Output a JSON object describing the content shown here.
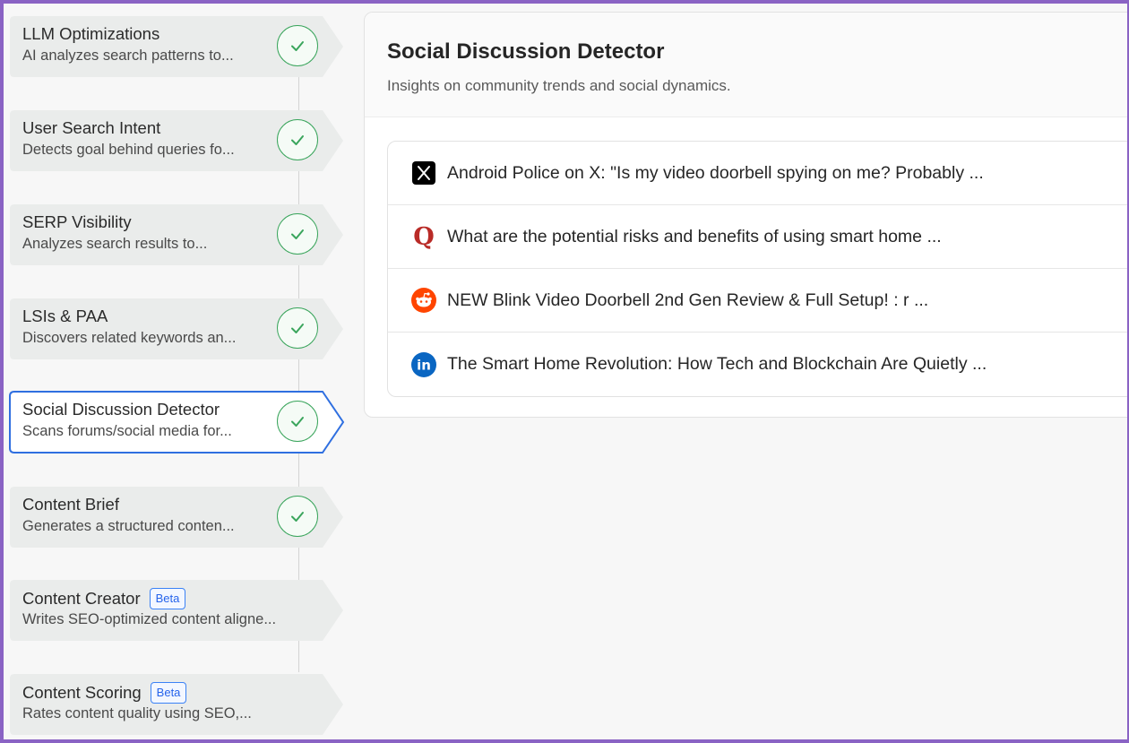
{
  "steps": [
    {
      "title": "LLM Optimizations",
      "desc": "AI analyzes search patterns to...",
      "badge": null,
      "active": false,
      "done": true
    },
    {
      "title": "User Search Intent",
      "desc": "Detects goal behind queries fo...",
      "badge": null,
      "active": false,
      "done": true
    },
    {
      "title": "SERP Visibility",
      "desc": "Analyzes search results to...",
      "badge": null,
      "active": false,
      "done": true
    },
    {
      "title": "LSIs & PAA",
      "desc": "Discovers related keywords an...",
      "badge": null,
      "active": false,
      "done": true
    },
    {
      "title": "Social Discussion Detector",
      "desc": "Scans forums/social media for...",
      "badge": null,
      "active": true,
      "done": true
    },
    {
      "title": "Content Brief",
      "desc": "Generates a structured conten...",
      "badge": null,
      "active": false,
      "done": true
    },
    {
      "title": "Content Creator",
      "desc": "Writes SEO-optimized content aligne...",
      "badge": "Beta",
      "active": false,
      "done": false
    },
    {
      "title": "Content Scoring",
      "desc": "Rates content quality using SEO,...",
      "badge": "Beta",
      "active": false,
      "done": false
    }
  ],
  "panel": {
    "title": "Social Discussion Detector",
    "subtitle": "Insights on community trends and social dynamics."
  },
  "discussions": [
    {
      "source": "x",
      "icon": "x-logo-icon",
      "text": "Android Police on X: \"Is my video doorbell spying on me? Probably ..."
    },
    {
      "source": "quora",
      "icon": "quora-logo-icon",
      "text": "What are the potential risks and benefits of using smart home ..."
    },
    {
      "source": "reddit",
      "icon": "reddit-logo-icon",
      "text": "NEW Blink Video Doorbell 2nd Gen Review & Full Setup! : r ..."
    },
    {
      "source": "linkedin",
      "icon": "linkedin-logo-icon",
      "text": "The Smart Home Revolution: How Tech and Blockchain Are Quietly ..."
    }
  ],
  "colors": {
    "frame": "#8a63c4",
    "active_border": "#2f6fe0",
    "check": "#3aa55c",
    "badge": "#2563eb",
    "quora": "#b92b27",
    "reddit": "#ff4500",
    "linkedin": "#0a66c2"
  }
}
